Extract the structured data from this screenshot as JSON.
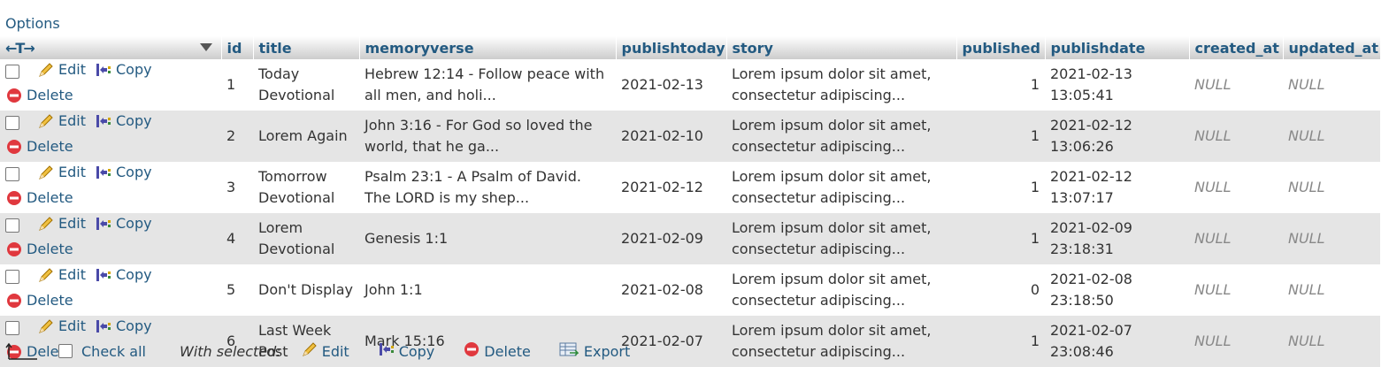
{
  "options_label": "Options",
  "columns": [
    "id",
    "title",
    "memoryverse",
    "publishtoday",
    "story",
    "published",
    "publishdate",
    "created_at",
    "updated_at"
  ],
  "actions": {
    "edit": "Edit",
    "copy": "Copy",
    "delete": "Delete"
  },
  "rows": [
    {
      "id": "1",
      "title": "Today Devotional",
      "memoryverse": "Hebrew 12:14 - Follow peace with all men, and holi...",
      "publishtoday": "2021-02-13",
      "story": "Lorem ipsum dolor sit amet, consectetur adipiscing...",
      "published": "1",
      "publishdate": "2021-02-13 13:05:41",
      "created_at": "NULL",
      "updated_at": "NULL"
    },
    {
      "id": "2",
      "title": "Lorem Again",
      "memoryverse": "John 3:16 - For God so loved the world, that he ga...",
      "publishtoday": "2021-02-10",
      "story": "Lorem ipsum dolor sit amet, consectetur adipiscing...",
      "published": "1",
      "publishdate": "2021-02-12 13:06:26",
      "created_at": "NULL",
      "updated_at": "NULL"
    },
    {
      "id": "3",
      "title": "Tomorrow Devotional",
      "memoryverse": "Psalm 23:1 - A Psalm of David. The LORD is my shep...",
      "publishtoday": "2021-02-12",
      "story": "Lorem ipsum dolor sit amet, consectetur adipiscing...",
      "published": "1",
      "publishdate": "2021-02-12 13:07:17",
      "created_at": "NULL",
      "updated_at": "NULL"
    },
    {
      "id": "4",
      "title": "Lorem Devotional",
      "memoryverse": "Genesis 1:1",
      "publishtoday": "2021-02-09",
      "story": "Lorem ipsum dolor sit amet, consectetur adipiscing...",
      "published": "1",
      "publishdate": "2021-02-09 23:18:31",
      "created_at": "NULL",
      "updated_at": "NULL"
    },
    {
      "id": "5",
      "title": "Don't Display",
      "memoryverse": "John 1:1",
      "publishtoday": "2021-02-08",
      "story": "Lorem ipsum dolor sit amet, consectetur adipiscing...",
      "published": "0",
      "publishdate": "2021-02-08 23:18:50",
      "created_at": "NULL",
      "updated_at": "NULL"
    },
    {
      "id": "6",
      "title": "Last Week Post",
      "memoryverse": "Mark 15:16",
      "publishtoday": "2021-02-07",
      "story": "Lorem ipsum dolor sit amet, consectetur adipiscing...",
      "published": "1",
      "publishdate": "2021-02-07 23:08:46",
      "created_at": "NULL",
      "updated_at": "NULL"
    }
  ],
  "footer": {
    "check_all": "Check all",
    "with_selected": "With selected:",
    "edit": "Edit",
    "copy": "Copy",
    "delete": "Delete",
    "export": "Export"
  },
  "icons": [
    "pencil-icon",
    "copy-icon",
    "delete-icon",
    "export-icon",
    "arrow-up-left-icon",
    "column-resize-icon",
    "sort-caret-icon"
  ],
  "colors": {
    "link": "#235a81",
    "row_alt": "#e5e5e5",
    "delete_red": "#e0383e"
  }
}
